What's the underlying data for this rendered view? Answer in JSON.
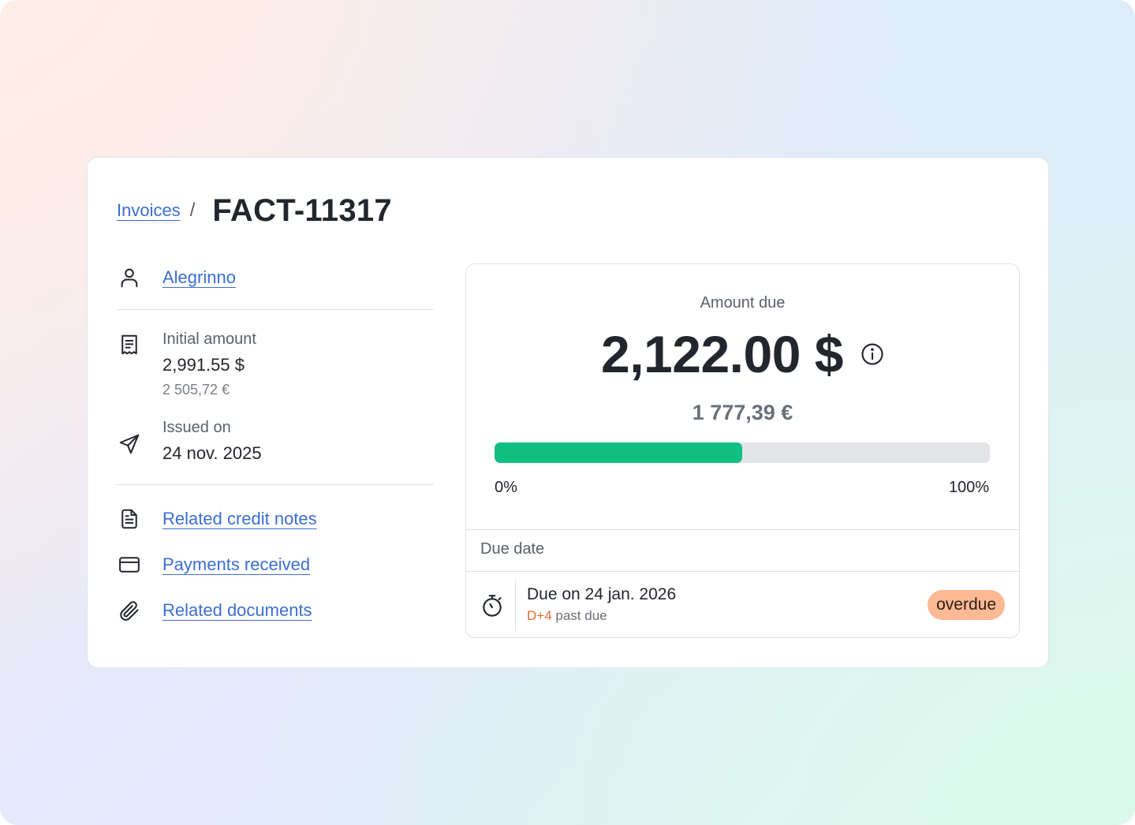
{
  "breadcrumb": {
    "parent": "Invoices",
    "separator": "/",
    "title": "FACT-11317"
  },
  "customer": {
    "name": "Alegrinno",
    "icon": "user-icon"
  },
  "initial_amount": {
    "label": "Initial amount",
    "value": "2,991.55 $",
    "converted": "2 505,72 €",
    "icon": "receipt-icon"
  },
  "issued": {
    "label": "Issued on",
    "value": "24 nov. 2025",
    "icon": "send-icon"
  },
  "links": {
    "credit_notes": {
      "label": "Related credit notes",
      "icon": "document-icon"
    },
    "payments": {
      "label": "Payments received",
      "icon": "credit-card-icon"
    },
    "documents": {
      "label": "Related documents",
      "icon": "paperclip-icon"
    }
  },
  "amount_due": {
    "label": "Amount due",
    "value": "2,122.00 $",
    "converted": "1 777,39 €",
    "info_icon": "info-icon",
    "progress": 0.5,
    "progress_min": "0%",
    "progress_max": "100%"
  },
  "due": {
    "header": "Due date",
    "title": "Due on 24 jan. 2026",
    "days": "D+4",
    "suffix": " past due",
    "badge": "overdue",
    "icon": "stopwatch-icon"
  },
  "colors": {
    "link": "#3b6fd1",
    "progress": "#10c083",
    "badge_bg": "#fdb894",
    "overdue_text": "#ee6a2c"
  }
}
